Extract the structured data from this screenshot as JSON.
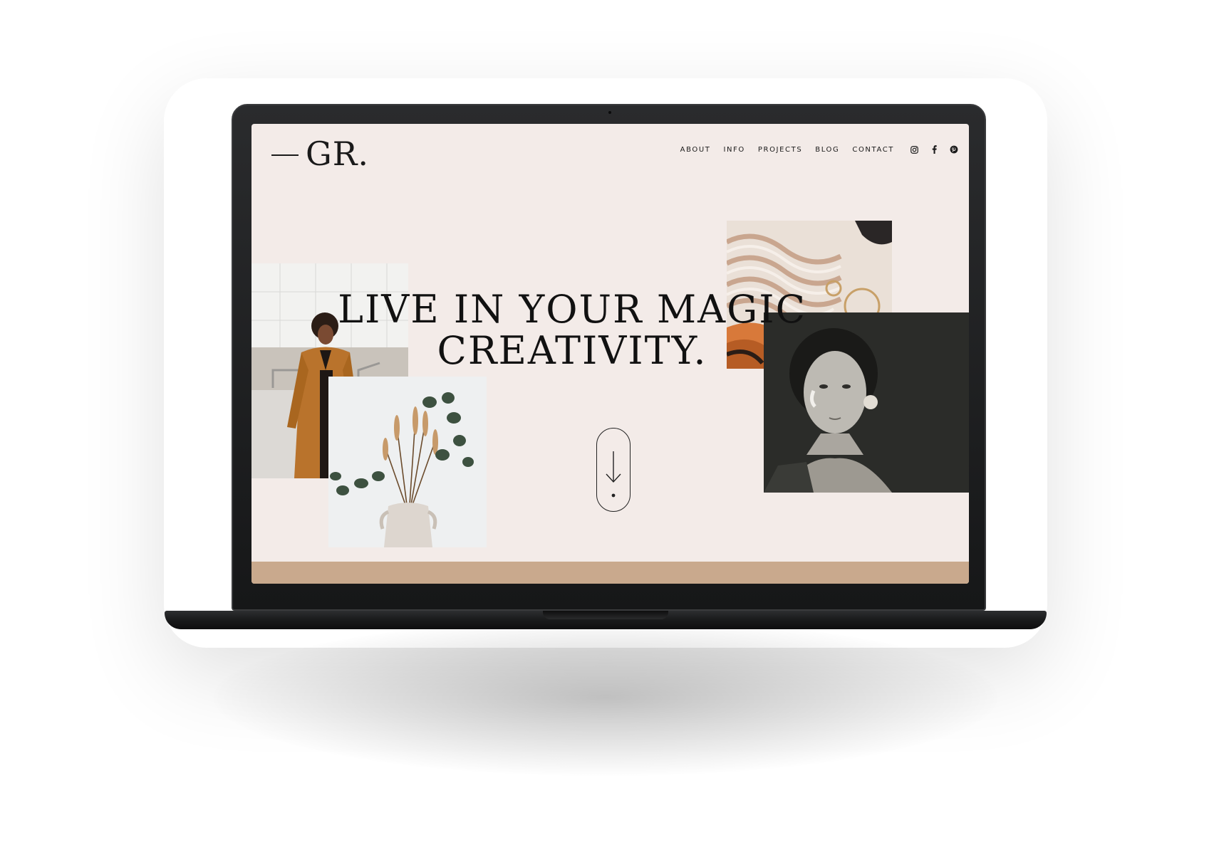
{
  "site": {
    "logo": "GR.",
    "nav": {
      "items": [
        {
          "label": "ABOUT"
        },
        {
          "label": "INFO"
        },
        {
          "label": "PROJECTS"
        },
        {
          "label": "BLOG"
        },
        {
          "label": "CONTACT"
        }
      ],
      "social_icons": [
        "instagram-icon",
        "facebook-icon",
        "pinterest-icon"
      ]
    },
    "hero": {
      "headline_line1": "LIVE IN YOUR MAGIC",
      "headline_line2": "CREATIVITY.",
      "scroll_icon": "arrow-down-icon"
    },
    "colors": {
      "background": "#f3ebe8",
      "accent_band": "#c9a98d",
      "text": "#1a1a1a",
      "device": "#1b1c1d"
    }
  }
}
